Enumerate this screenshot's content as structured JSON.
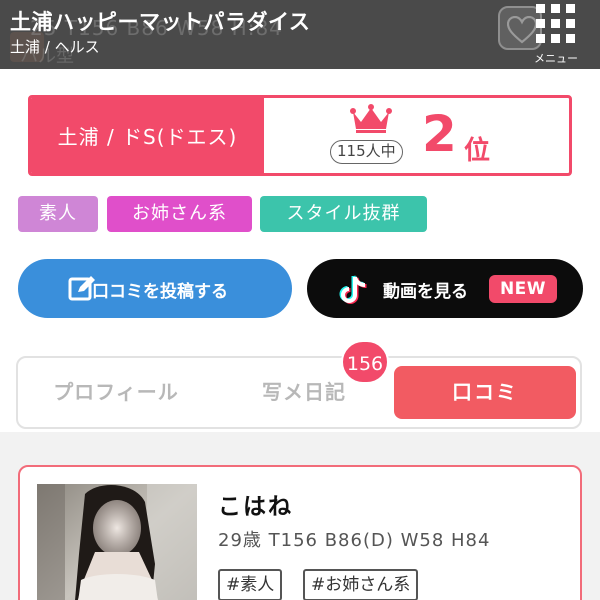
{
  "header": {
    "store_name": "土浦ハッピーマットパラダイス",
    "breadcrumb": "土浦 / ヘルス",
    "menu_label": "メニュー",
    "bg_ghost_line1": "25 T156 B86 W58 H:84",
    "bg_ghost_line2": "ハル型"
  },
  "ranking": {
    "area_label": "土浦 / ドS(ドエス)",
    "total": "115人中",
    "rank": "2",
    "rank_unit": "位",
    "color": "#f24a6a"
  },
  "tags": [
    {
      "label": "素人",
      "color": "#cf86d6"
    },
    {
      "label": "お姉さん系",
      "color": "#e04fca"
    },
    {
      "label": "スタイル抜群",
      "color": "#3cc4ab"
    }
  ],
  "actions": {
    "review_label": "口コミを投稿する",
    "video_label": "動画を見る",
    "new_badge": "NEW"
  },
  "tabs": {
    "items": [
      "プロフィール",
      "写メ日記",
      "口コミ"
    ],
    "active": "口コミ",
    "diary_count": "156"
  },
  "profile_card": {
    "name": "こはね",
    "spec": "29歳  T156  B86(D)  W58  H84",
    "tags": [
      "#素人",
      "#お姉さん系"
    ],
    "border_color": "#f26c7a"
  },
  "icons": {
    "heart": "heart-icon",
    "menu": "grid-menu-icon",
    "crown": "crown-icon",
    "edit": "edit-icon",
    "tiktok": "tiktok-icon"
  }
}
